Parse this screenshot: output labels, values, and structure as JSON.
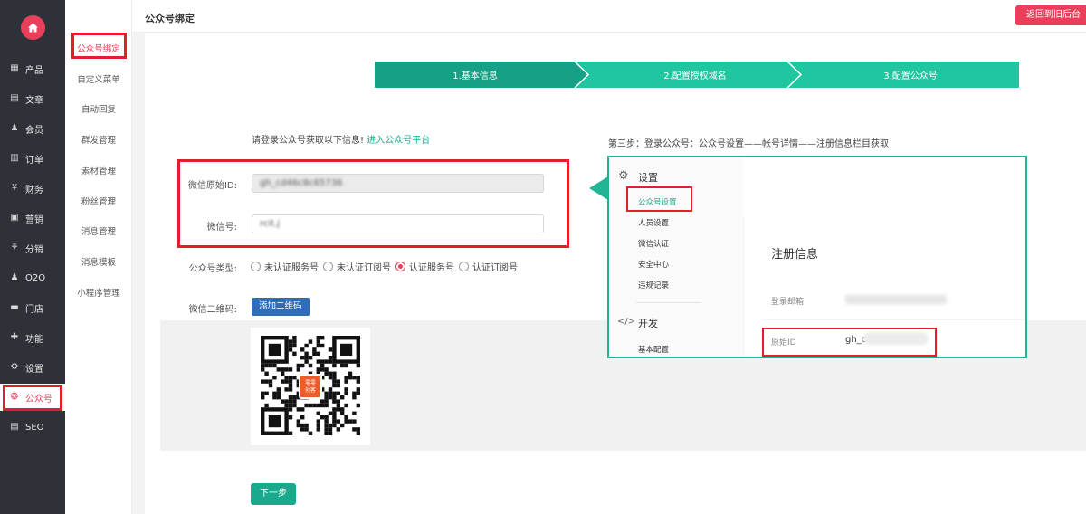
{
  "header": {
    "title": "公众号绑定",
    "back": "返回到旧后台"
  },
  "nav": {
    "items": [
      {
        "label": "产品",
        "icon": "grid-icon"
      },
      {
        "label": "文章",
        "icon": "document-icon"
      },
      {
        "label": "会员",
        "icon": "user-icon"
      },
      {
        "label": "订单",
        "icon": "order-icon"
      },
      {
        "label": "财务",
        "icon": "yen-icon"
      },
      {
        "label": "营销",
        "icon": "gift-icon"
      },
      {
        "label": "分销",
        "icon": "tree-icon"
      },
      {
        "label": "O2O",
        "icon": "user-group-icon"
      },
      {
        "label": "门店",
        "icon": "store-icon"
      },
      {
        "label": "功能",
        "icon": "puzzle-icon"
      },
      {
        "label": "设置",
        "icon": "gear-icon"
      },
      {
        "label": "公众号",
        "icon": "wechat-icon"
      },
      {
        "label": "SEO",
        "icon": "file-icon"
      }
    ]
  },
  "subnav": {
    "items": [
      "公众号绑定",
      "自定义菜单",
      "自动回复",
      "群发管理",
      "素材管理",
      "粉丝管理",
      "消息管理",
      "消息模板",
      "小程序管理"
    ]
  },
  "steps": [
    "1.基本信息",
    "2.配置授权域名",
    "3.配置公众号"
  ],
  "intro": {
    "text": "请登录公众号获取以下信息!",
    "link": "进入公众号平台"
  },
  "form": {
    "raw_id_label": "微信原始ID:",
    "raw_id_value": "gh_cd46c8c65736",
    "wechat_label": "微信号:",
    "wechat_value": "rcit.j",
    "type_label": "公众号类型:",
    "type_options": [
      "未认证服务号",
      "未认证订阅号",
      "认证服务号",
      "认证订阅号"
    ],
    "qr_label": "微信二维码:",
    "qr_button": "添加二维码",
    "qr_badge": [
      "零零",
      "创客"
    ],
    "next": "下一步"
  },
  "help": {
    "caption": "第三步：登录公众号：公众号设置——帐号详情——注册信息栏目获取",
    "settings_title": "设置",
    "settings_items": [
      "公众号设置",
      "人员设置",
      "微信认证",
      "安全中心",
      "违规记录"
    ],
    "dev_title": "开发",
    "dev_items": [
      "基本配置"
    ],
    "reg_title": "注册信息",
    "email_label": "登录邮箱",
    "rawid_label": "原始ID",
    "rawid_value": "gh_c"
  },
  "colors": {
    "accent": "#e8405b",
    "teal": "#19aa8d",
    "nav": "#2e3238",
    "highlight": "#e21f2b",
    "blue": "#2f6eb7"
  }
}
